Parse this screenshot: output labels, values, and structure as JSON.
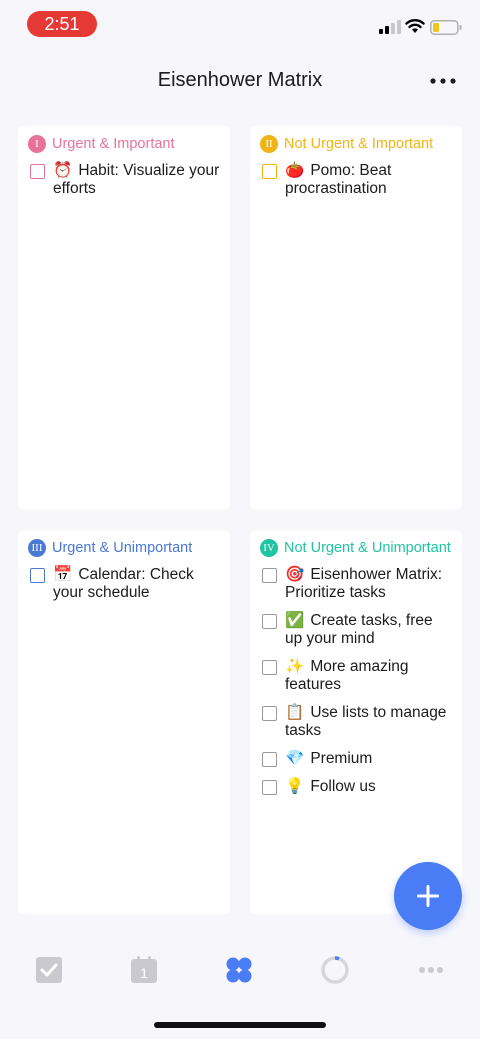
{
  "status_bar": {
    "time": "2:51"
  },
  "header": {
    "title": "Eisenhower Matrix"
  },
  "colors": {
    "q1": "#e8739a",
    "q2": "#f0b416",
    "q3": "#4a78d4",
    "q4": "#1fc4a0",
    "accent": "#4a7cf6"
  },
  "quadrants": [
    {
      "roman": "I",
      "title": "Urgent & Important",
      "tasks": [
        {
          "emoji": "⏰",
          "text": "Habit: Visualize your efforts"
        }
      ]
    },
    {
      "roman": "II",
      "title": "Not Urgent & Important",
      "tasks": [
        {
          "emoji": "🍅",
          "text": "Pomo: Beat procrastination"
        }
      ]
    },
    {
      "roman": "III",
      "title": "Urgent & Unimportant",
      "tasks": [
        {
          "emoji": "📅",
          "text": "Calendar: Check your schedule"
        }
      ]
    },
    {
      "roman": "IV",
      "title": "Not Urgent & Unimportant",
      "tasks": [
        {
          "emoji": "🎯",
          "text": "Eisenhower Matrix: Prioritize tasks"
        },
        {
          "emoji": "✅",
          "text": "Create tasks, free up your mind"
        },
        {
          "emoji": "✨",
          "text": "More amazing features"
        },
        {
          "emoji": "📋",
          "text": "Use lists to manage tasks"
        },
        {
          "emoji": "💎",
          "text": "Premium"
        },
        {
          "emoji": "💡",
          "text": "Follow us"
        }
      ]
    }
  ],
  "tabbar": {
    "calendar_day": "1",
    "tabs": [
      "checkmark-icon",
      "calendar-icon",
      "matrix-icon",
      "pomodoro-icon",
      "more-icon"
    ]
  }
}
